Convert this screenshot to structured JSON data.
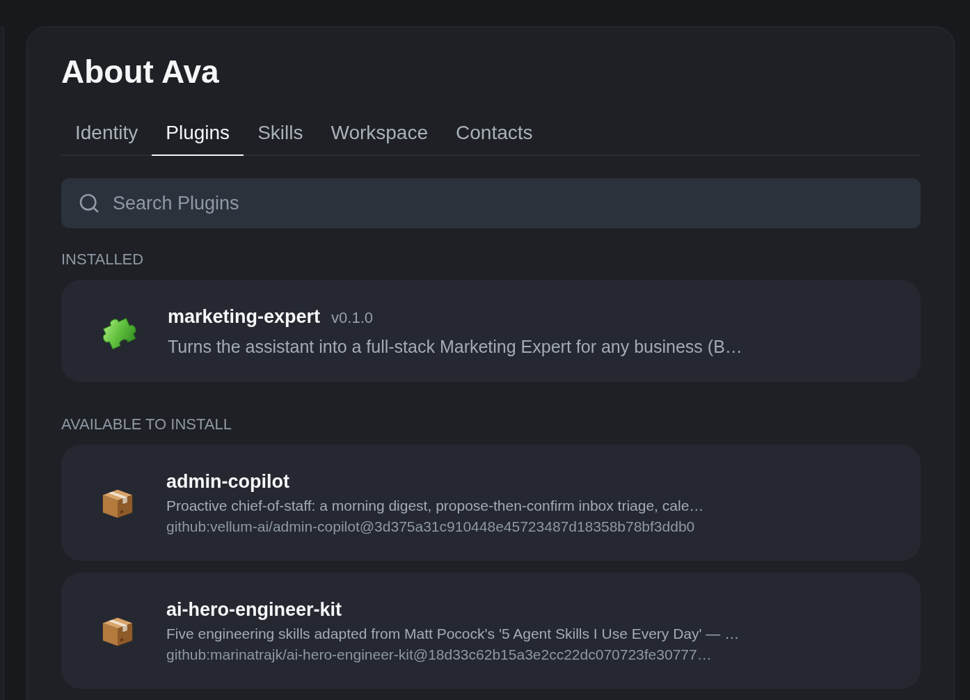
{
  "panel": {
    "title": "About Ava"
  },
  "tabs": [
    {
      "label": "Identity",
      "selected": false
    },
    {
      "label": "Plugins",
      "selected": true
    },
    {
      "label": "Skills",
      "selected": false
    },
    {
      "label": "Workspace",
      "selected": false
    },
    {
      "label": "Contacts",
      "selected": false
    }
  ],
  "search": {
    "placeholder": "Search Plugins"
  },
  "sections": [
    {
      "heading": "INSTALLED",
      "plugins": [
        {
          "kind": "installed",
          "name": "marketing-expert",
          "version": "v0.1.0",
          "description": "Turns the assistant into a full-stack Marketing Expert for any business (B…"
        }
      ]
    },
    {
      "heading": "AVAILABLE TO INSTALL",
      "plugins": [
        {
          "kind": "available",
          "name": "admin-copilot",
          "description": "Proactive chief-of-staff: a morning digest, propose-then-confirm inbox triage, cale…",
          "source": "github:vellum-ai/admin-copilot@3d375a31c910448e45723487d18358b78bf3ddb0"
        },
        {
          "kind": "available",
          "name": "ai-hero-engineer-kit",
          "description": "Five engineering skills adapted from Matt Pocock's '5 Agent Skills I Use Every Day' — …",
          "source": "github:marinatrajk/ai-hero-engineer-kit@18d33c62b15a3e2cc22dc070723fe30777…"
        }
      ]
    }
  ]
}
